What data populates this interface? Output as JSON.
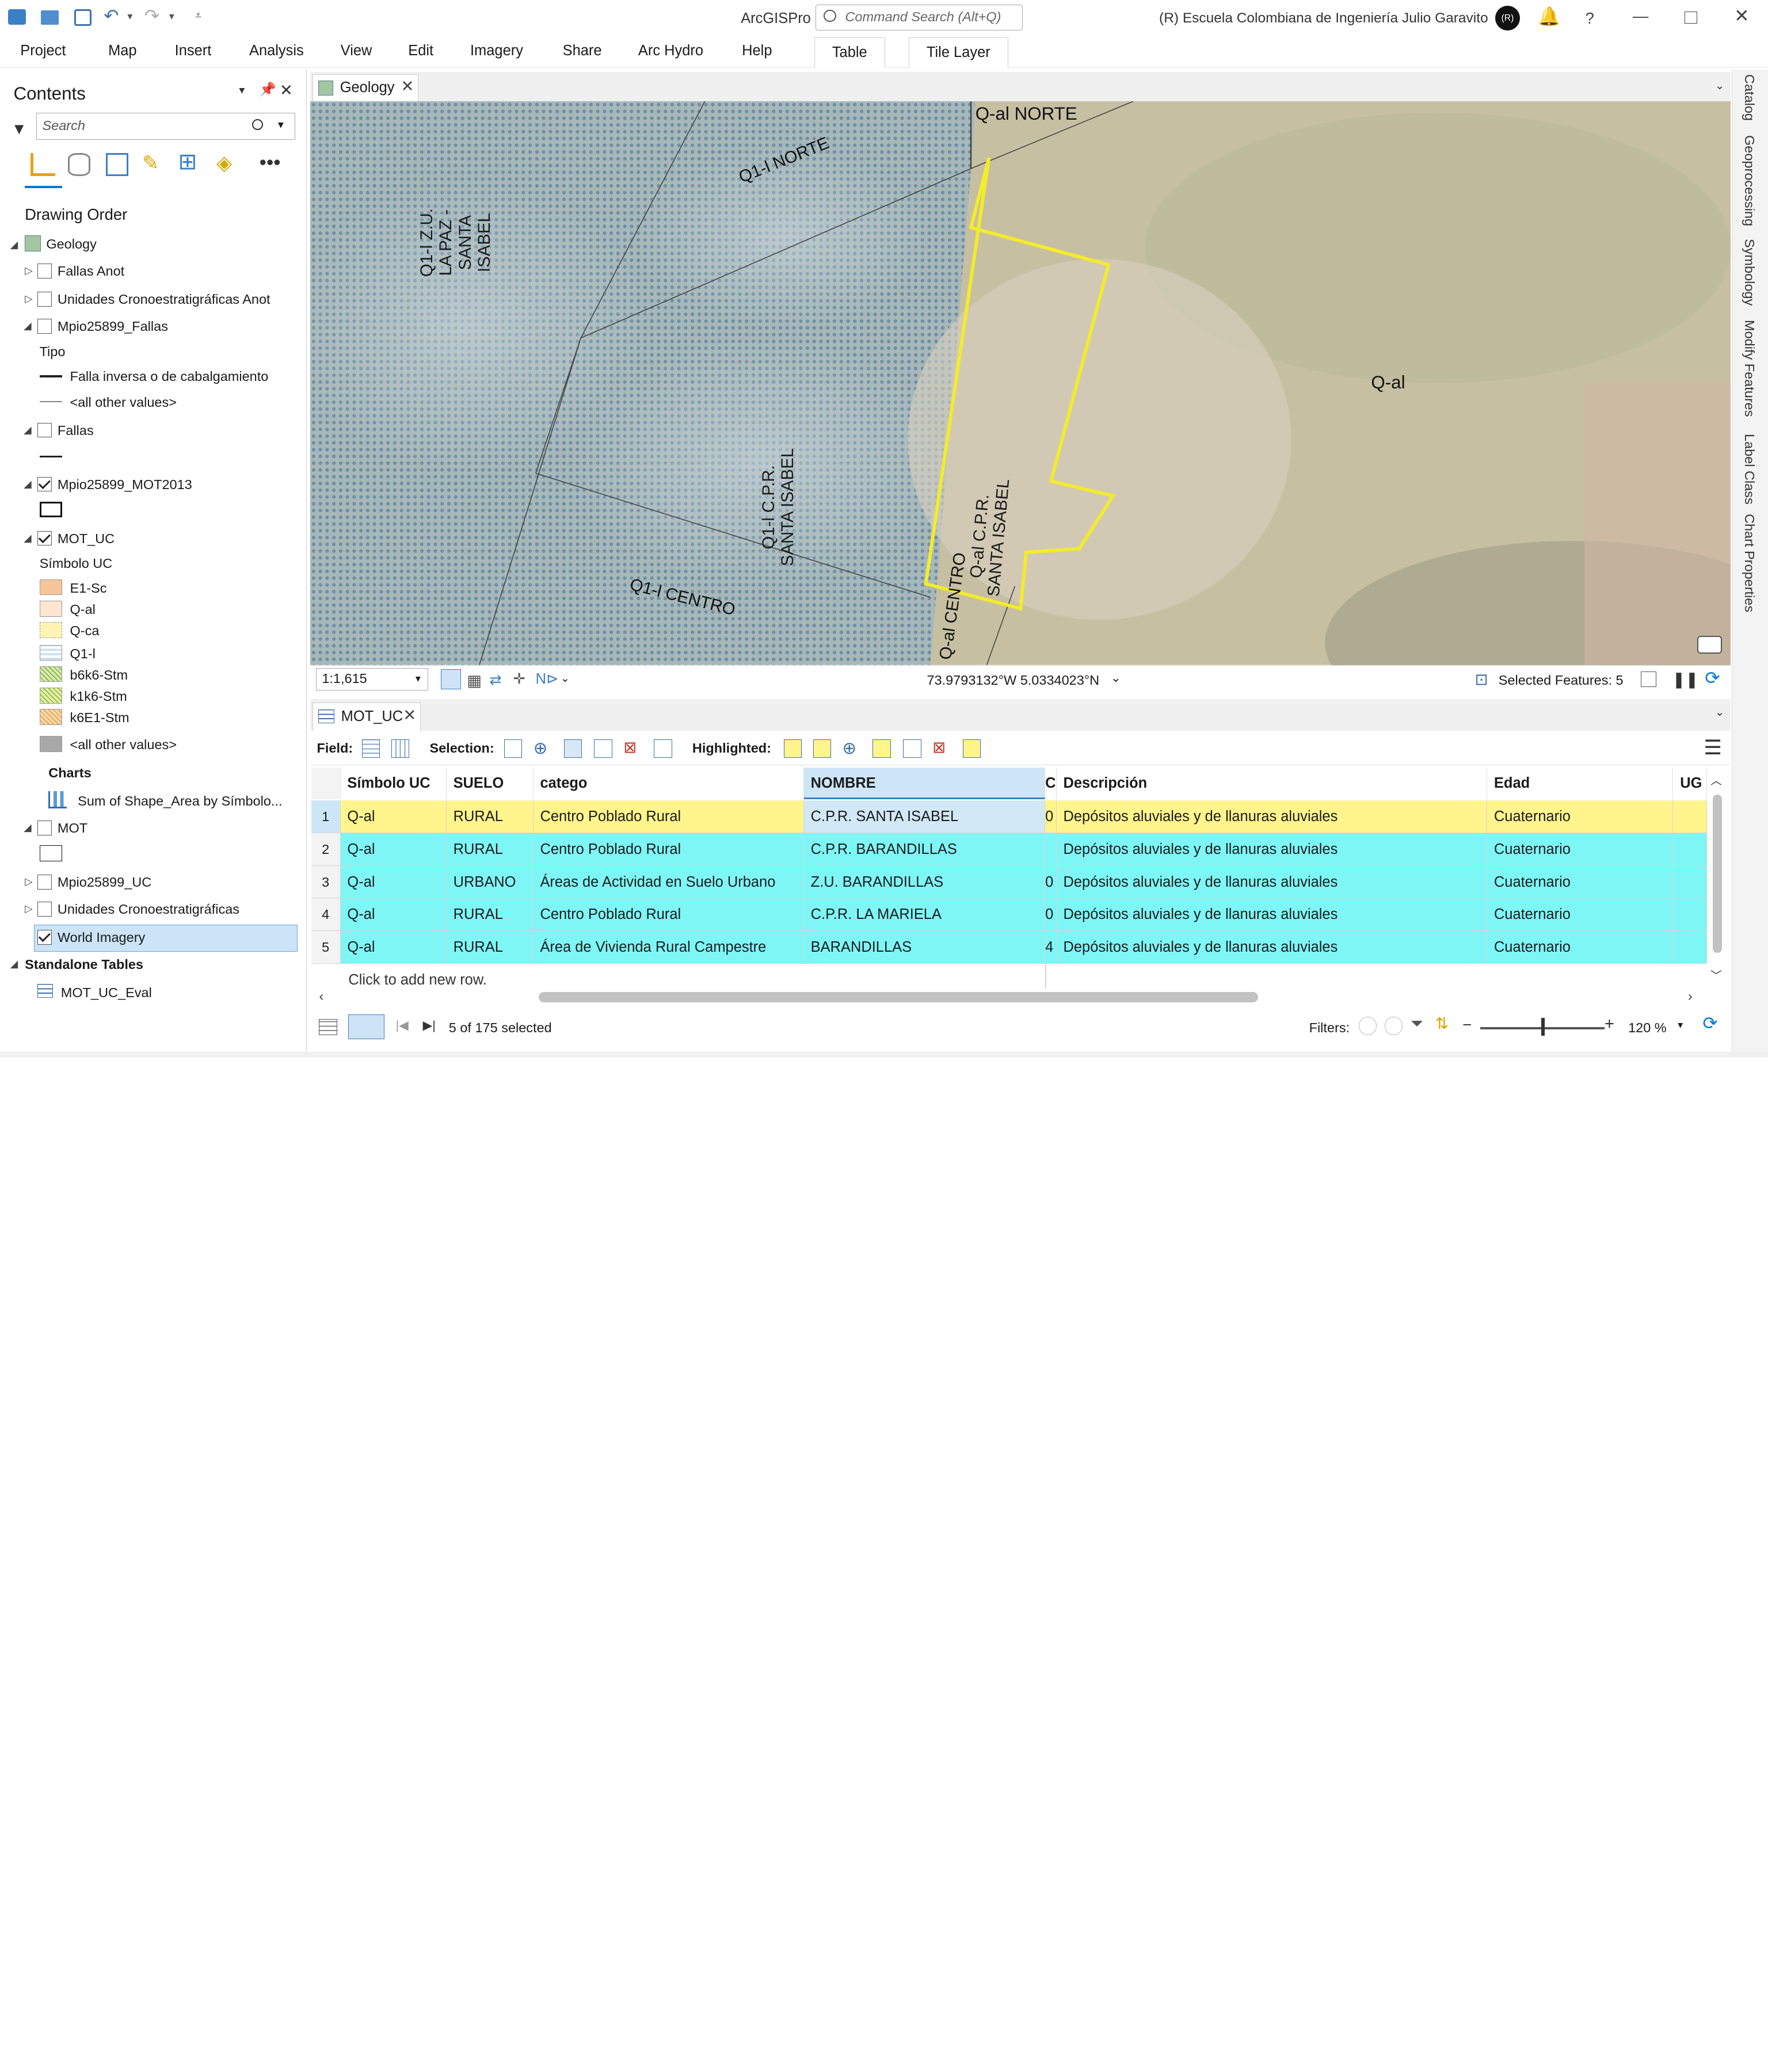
{
  "app": {
    "title": "ArcGISPro",
    "command_search_placeholder": "Command Search (Alt+Q)",
    "org": "(R)  Escuela Colombiana de Ingeniería Julio Garavito",
    "avatar_initials": "(R)"
  },
  "ribbon": {
    "tabs": [
      "Project",
      "Map",
      "Insert",
      "Analysis",
      "View",
      "Edit",
      "Imagery",
      "Share",
      "Arc Hydro",
      "Help"
    ],
    "context_tabs": [
      "Table",
      "Tile Layer"
    ]
  },
  "contents": {
    "title": "Contents",
    "search_placeholder": "Search",
    "drawing_order": "Drawing Order",
    "items": {
      "geology": "Geology",
      "fallas_anot": "Fallas Anot",
      "unidades_anot": "Unidades Cronoestratigráficas Anot",
      "mpio_fallas": "Mpio25899_Fallas",
      "tipo": "Tipo",
      "falla_inversa": "Falla inversa o de cabalgamiento",
      "all_other_1": "<all other values>",
      "fallas": "Fallas",
      "mpio_mot2013": "Mpio25899_MOT2013",
      "mot_uc": "MOT_UC",
      "simbolo_uc": "Símbolo UC",
      "sym_e1sc": "E1-Sc",
      "sym_qal": "Q-al",
      "sym_qca": "Q-ca",
      "sym_q1l": "Q1-l",
      "sym_b6k6": "b6k6-Stm",
      "sym_k1k6": "k1k6-Stm",
      "sym_k6e1": "k6E1-Stm",
      "all_other_2": "<all other values>",
      "charts": "Charts",
      "chart_sum": "Sum of Shape_Area by Símbolo...",
      "mot": "MOT",
      "mpio_uc": "Mpio25899_UC",
      "unidades": "Unidades Cronoestratigráficas",
      "world_imagery": "World Imagery",
      "standalone": "Standalone Tables",
      "mot_uc_eval": "MOT_UC_Eval"
    }
  },
  "map": {
    "tab": "Geology",
    "labels": {
      "qal_norte": "Q-al NORTE",
      "q1l_norte": "Q1-l NORTE",
      "q1l_zu_1": "Q1-l Z.U.",
      "q1l_zu_2": "LA PAZ -",
      "q1l_zu_3": "SANTA ISABEL",
      "q1l_cpr_1": "Q1-l C.P.R.",
      "q1l_cpr_2": "SANTA ISABEL",
      "qal_cpr_1": "Q-al C.P.R.",
      "qal_cpr_2": "SANTA ISABEL",
      "qal": "Q-al",
      "q1l_centro": "Q1-l CENTRO",
      "qal_centro": "Q-al CENTRO"
    },
    "scale": "1:1,615",
    "coords": "73.9793132°W 5.0334023°N",
    "selected_features": "Selected Features: 5"
  },
  "table": {
    "tab": "MOT_UC",
    "toolbar": {
      "field": "Field:",
      "selection": "Selection:",
      "highlighted": "Highlighted:"
    },
    "columns": [
      "Símbolo UC",
      "SUELO",
      "catego",
      "NOMBRE",
      "C",
      "Descripción",
      "Edad",
      "UG"
    ],
    "rows": [
      {
        "n": "1",
        "simbolo": "Q-al",
        "suelo": "RURAL",
        "catego": "Centro Poblado Rural",
        "nombre": "C.P.R. SANTA ISABEL",
        "c": "0",
        "desc": "Depósitos aluviales y de llanuras aluviales",
        "edad": "Cuaternario"
      },
      {
        "n": "2",
        "simbolo": "Q-al",
        "suelo": "RURAL",
        "catego": "Centro Poblado Rural",
        "nombre": "C.P.R. BARANDILLAS",
        "c": "",
        "desc": "Depósitos aluviales y de llanuras aluviales",
        "edad": "Cuaternario"
      },
      {
        "n": "3",
        "simbolo": "Q-al",
        "suelo": "URBANO",
        "catego": "Áreas de Actividad en Suelo Urbano",
        "nombre": "Z.U. BARANDILLAS",
        "c": "0",
        "desc": "Depósitos aluviales y de llanuras aluviales",
        "edad": "Cuaternario"
      },
      {
        "n": "4",
        "simbolo": "Q-al",
        "suelo": "RURAL",
        "catego": "Centro Poblado Rural",
        "nombre": "C.P.R. LA MARIELA",
        "c": "0",
        "desc": "Depósitos aluviales y de llanuras aluviales",
        "edad": "Cuaternario"
      },
      {
        "n": "5",
        "simbolo": "Q-al",
        "suelo": "RURAL",
        "catego": "Área de Vivienda Rural Campestre",
        "nombre": "BARANDILLAS",
        "c": "4",
        "desc": "Depósitos aluviales y de llanuras aluviales",
        "edad": "Cuaternario"
      }
    ],
    "add_row": "Click to add new row.",
    "status": "5 of 175 selected",
    "filters": "Filters:",
    "zoom": "120 %"
  },
  "right_dock": [
    "Catalog",
    "Geoprocessing",
    "Symbology",
    "Modify Features",
    "Label Class",
    "Chart Properties"
  ],
  "colors": {
    "selected_row": "#fff58c",
    "highlight_row": "#7ef6f6",
    "active_header": "#cde6f7",
    "accent": "#0078d4"
  }
}
